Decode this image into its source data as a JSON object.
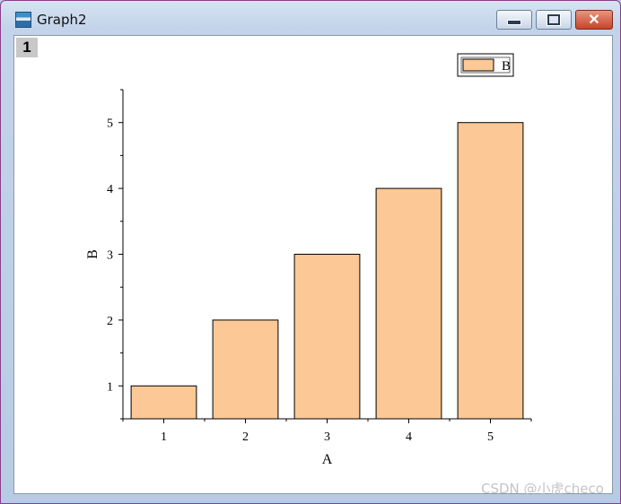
{
  "window": {
    "title": "Graph2",
    "layer_label": "1"
  },
  "watermark": "CSDN @小虎checo",
  "colors": {
    "bar_fill": "#fcc896",
    "bar_stroke": "#000000"
  },
  "chart_data": {
    "type": "bar",
    "categories": [
      "1",
      "2",
      "3",
      "4",
      "5"
    ],
    "values": [
      1,
      2,
      3,
      4,
      5
    ],
    "series": [
      {
        "name": "B",
        "values": [
          1,
          2,
          3,
          4,
          5
        ]
      }
    ],
    "xlabel": "A",
    "ylabel": "B",
    "ylim": [
      0.5,
      5.5
    ],
    "yticks": [
      1,
      2,
      3,
      4,
      5
    ],
    "grid": false,
    "legend": "top-right"
  }
}
